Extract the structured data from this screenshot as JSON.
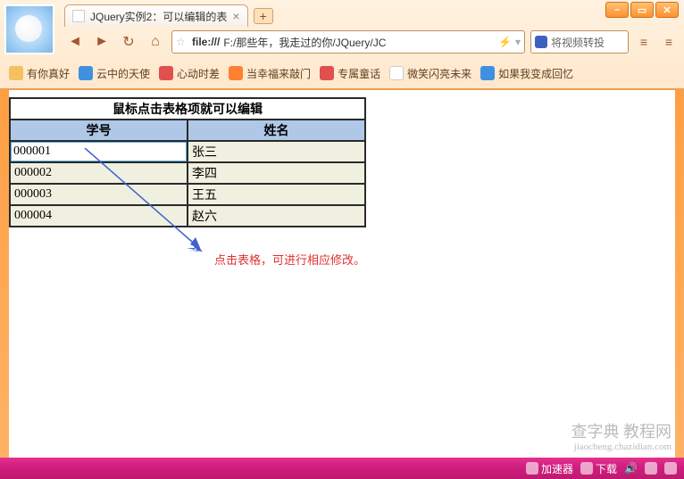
{
  "window": {
    "minimize": "–",
    "maximize": "▭",
    "close": "✕"
  },
  "tab": {
    "title": "JQuery实例2：可以编辑的表",
    "close": "×",
    "new_tab": "+"
  },
  "nav": {
    "back": "◄",
    "forward": "►",
    "refresh": "↻",
    "home": "⌂",
    "url_prefix": "file:///",
    "url_text": "F:/那些年，我走过的你/JQuery/JC",
    "star": "☆",
    "lightning": "⚡",
    "dropdown": "▾",
    "search_hint": "将视频转投",
    "tool1": "≡",
    "tool2": "≡"
  },
  "bookmarks": {
    "items": [
      {
        "label": "有你真好",
        "cls": "bm-folder"
      },
      {
        "label": "云中的天使",
        "cls": "bm-blue"
      },
      {
        "label": "心动时差",
        "cls": "bm-red"
      },
      {
        "label": "当幸福来敲门",
        "cls": "bm-orange"
      },
      {
        "label": "专属童话",
        "cls": "bm-red"
      },
      {
        "label": "微笑闪亮未来",
        "cls": "bm-white"
      },
      {
        "label": "如果我变成回忆",
        "cls": "bm-blue"
      }
    ]
  },
  "table": {
    "title": "鼠标点击表格项就可以编辑",
    "col1_header": "学号",
    "col2_header": "姓名",
    "rows": [
      {
        "id": "000001",
        "name": "张三",
        "editing": true
      },
      {
        "id": "000002",
        "name": "李四",
        "editing": false
      },
      {
        "id": "000003",
        "name": "王五",
        "editing": false
      },
      {
        "id": "000004",
        "name": "赵六",
        "editing": false
      }
    ]
  },
  "annotation": {
    "text": "点击表格，可进行相应修改。"
  },
  "status": {
    "accel": "加速器",
    "download": "下载",
    "sound": "🔊"
  },
  "watermark": {
    "main": "查字典 教程网",
    "sub": "jiaocheng.chazidian.com"
  }
}
